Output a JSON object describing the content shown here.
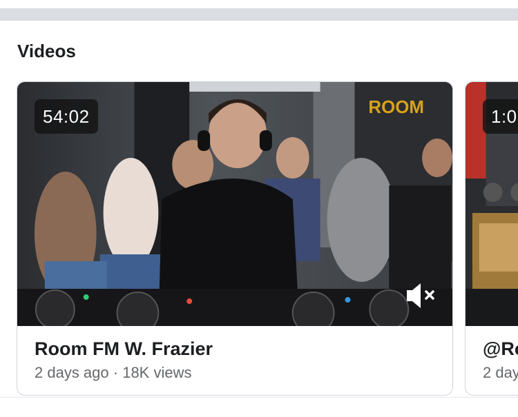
{
  "section": {
    "title": "Videos"
  },
  "videos": [
    {
      "duration": "54:02",
      "title": "Room FM W. Frazier",
      "age": "2 days ago",
      "separator": " · ",
      "views": "18K views",
      "logo_text": "ROOM",
      "muted": true
    },
    {
      "duration": "1:0",
      "title": "@Ro",
      "age": "2 day",
      "separator": "",
      "views": ""
    }
  ],
  "colors": {
    "divider": "#dadde1",
    "title_text": "#1c1e21",
    "secondary_text": "#65676b",
    "logo_gold": "#d9a21b",
    "card_border": "#d0d3d8"
  },
  "icons": [
    "volume-muted-icon"
  ]
}
